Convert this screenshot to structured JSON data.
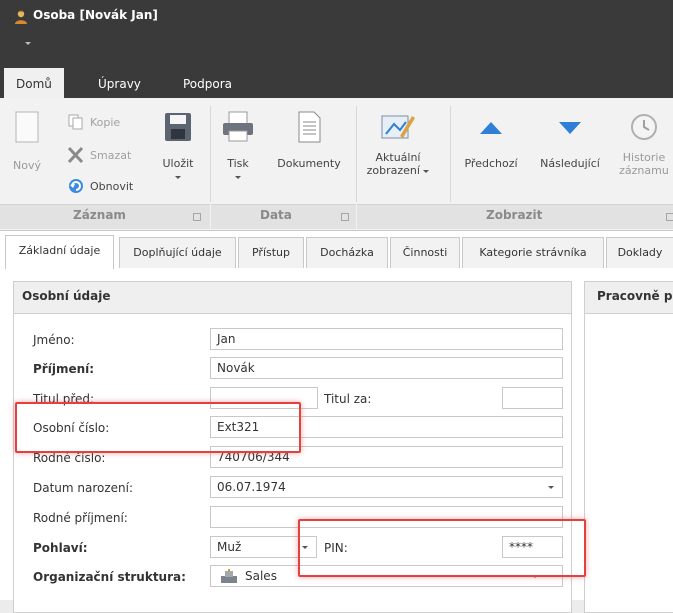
{
  "window": {
    "title": "Osoba [Novák Jan]",
    "icon": "user-icon"
  },
  "ribbon_tabs": [
    {
      "label": "Domů",
      "active": true
    },
    {
      "label": "Úpravy",
      "active": false
    },
    {
      "label": "Podpora",
      "active": false
    }
  ],
  "ribbon": {
    "novy": "Nový",
    "kopie": "Kopie",
    "smazat": "Smazat",
    "obnovit": "Obnovit",
    "ulozit": "Uložit",
    "tisk": "Tisk",
    "dokumenty": "Dokumenty",
    "aktualni_line1": "Aktuální",
    "aktualni_line2": "zobrazení",
    "predchozi": "Předchozí",
    "nasledujici": "Následující",
    "historie_line1": "Historie",
    "historie_line2": "záznamu",
    "groups": {
      "zaznam": "Záznam",
      "data": "Data",
      "zobrazit": "Zobrazit"
    }
  },
  "form_tabs": [
    "Základní údaje",
    "Doplňující údaje",
    "Přístup",
    "Docházka",
    "Činnosti",
    "Kategorie strávníka",
    "Doklady"
  ],
  "panel": {
    "title": "Osobní údaje",
    "jmeno_label": "Jméno:",
    "jmeno_value": "Jan",
    "prijmeni_label": "Příjmení:",
    "prijmeni_value": "Novák",
    "titul_pred_label": "Titul před:",
    "titul_pred_value": "",
    "titul_za_label": "Titul za:",
    "titul_za_value": "",
    "osobni_cislo_label": "Osobní číslo:",
    "osobni_cislo_value": "Ext321",
    "rodne_cislo_label": "Rodné číslo:",
    "rodne_cislo_value": "740706/344",
    "datum_label": "Datum narození:",
    "datum_value": "06.07.1974",
    "rodne_prijmeni_label": "Rodné příjmení:",
    "rodne_prijmeni_value": "",
    "pohlavi_label": "Pohlaví:",
    "pohlavi_value": "Muž",
    "pin_label": "PIN:",
    "pin_value": "****",
    "org_label": "Organizační struktura:",
    "org_value": "Sales"
  },
  "panel2": {
    "title": "Pracovně p"
  },
  "colors": {
    "titlebar": "#3a3a3a",
    "accent_blue": "#2f7fd6",
    "highlight_red": "#e34040"
  }
}
